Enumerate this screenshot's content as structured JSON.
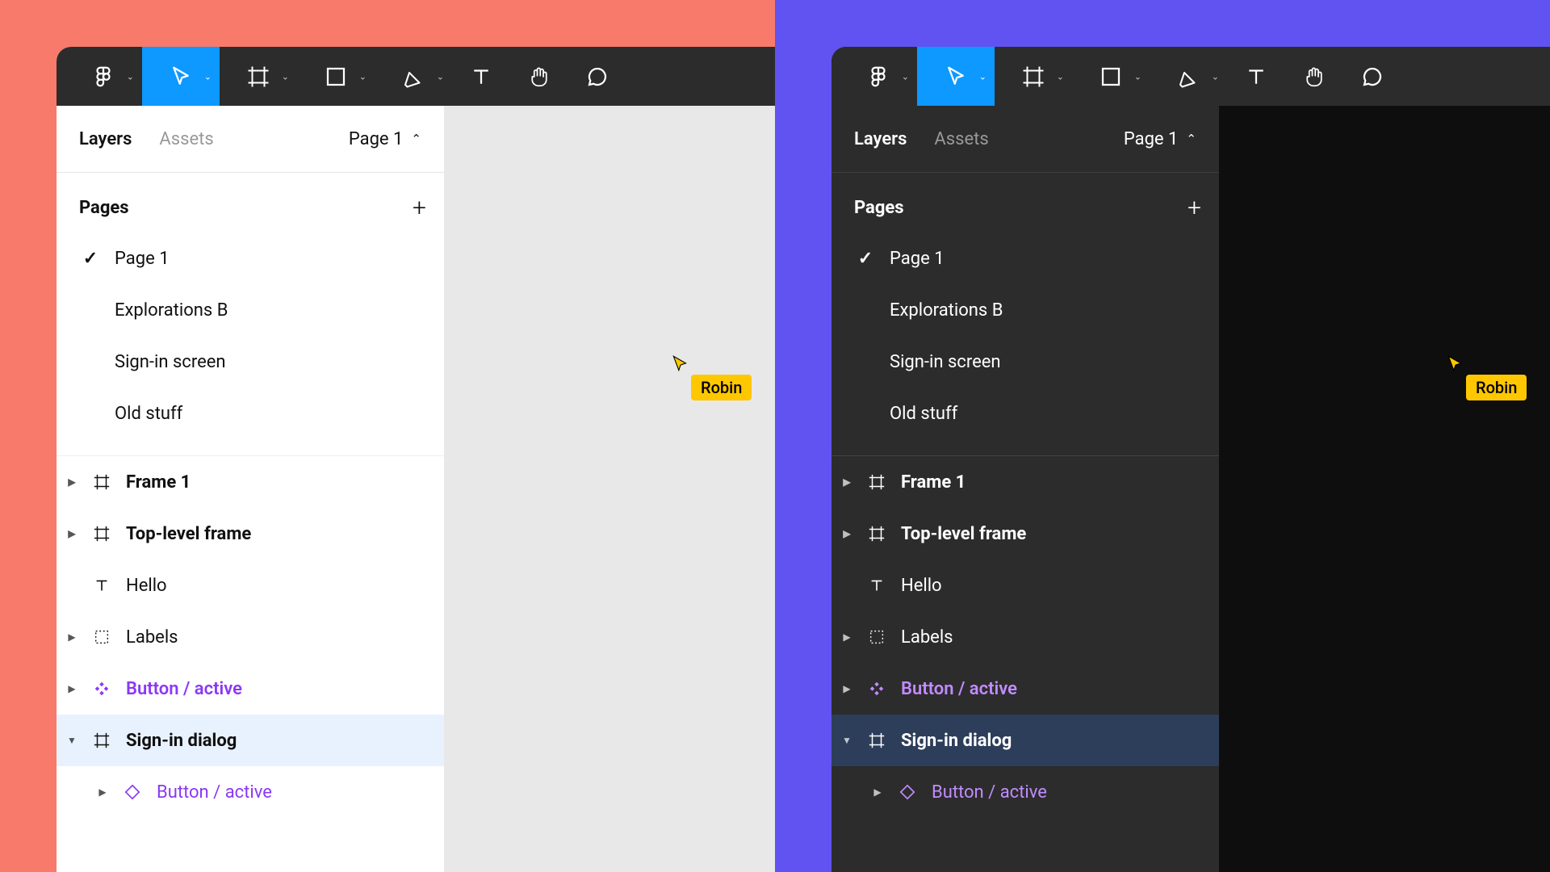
{
  "tabs": {
    "layers": "Layers",
    "assets": "Assets",
    "page_selector": "Page 1"
  },
  "section": {
    "pages": "Pages"
  },
  "pages": [
    {
      "name": "Page 1",
      "active": true
    },
    {
      "name": "Explorations B",
      "active": false
    },
    {
      "name": "Sign-in screen",
      "active": false
    },
    {
      "name": "Old stuff",
      "active": false
    }
  ],
  "layers": [
    {
      "name": "Frame 1",
      "type": "frame",
      "bold": true
    },
    {
      "name": "Top-level frame",
      "type": "frame",
      "bold": true
    },
    {
      "name": "Hello",
      "type": "text",
      "bold": false
    },
    {
      "name": "Labels",
      "type": "group",
      "bold": false
    },
    {
      "name": "Button / active",
      "type": "component",
      "bold": false
    },
    {
      "name": "Sign-in dialog",
      "type": "frame",
      "bold": true,
      "selected": true,
      "expanded": true
    },
    {
      "name": "Button / active",
      "type": "instance",
      "bold": false,
      "nested": true
    }
  ],
  "collaborator": {
    "name": "Robin",
    "color": "#ffc700"
  },
  "toolbar_tools": [
    "logo",
    "move",
    "frame",
    "shape",
    "pen",
    "text",
    "hand",
    "comment"
  ]
}
